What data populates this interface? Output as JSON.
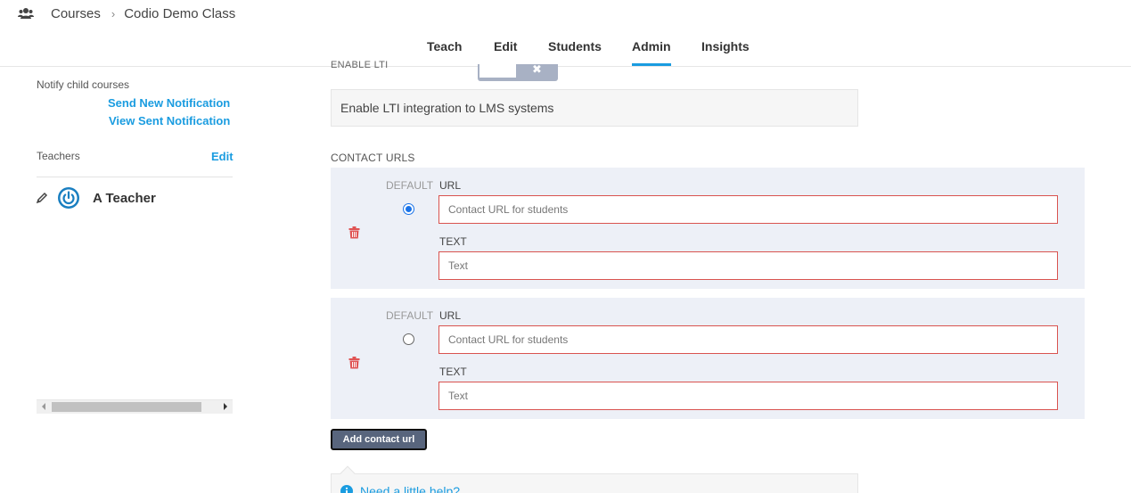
{
  "breadcrumb": {
    "icon": "users-icon",
    "root": "Courses",
    "current": "Codio Demo Class"
  },
  "tabs": [
    {
      "label": "Teach",
      "active": false
    },
    {
      "label": "Edit",
      "active": false
    },
    {
      "label": "Students",
      "active": false
    },
    {
      "label": "Admin",
      "active": true
    },
    {
      "label": "Insights",
      "active": false
    }
  ],
  "sidebar": {
    "notify_label": "Notify child courses",
    "send_new": "Send New Notification",
    "view_sent": "View Sent Notification",
    "teachers_label": "Teachers",
    "teachers_edit": "Edit",
    "teacher_name": "A Teacher"
  },
  "main": {
    "lti_label": "ENABLE LTI",
    "lti_description": "Enable LTI integration to LMS systems",
    "contact_urls_title": "CONTACT URLS",
    "contact_cards": [
      {
        "default_label": "DEFAULT",
        "url_label": "URL",
        "url_placeholder": "Contact URL for students",
        "text_label": "TEXT",
        "text_placeholder": "Text",
        "is_default": true
      },
      {
        "default_label": "DEFAULT",
        "url_label": "URL",
        "url_placeholder": "Contact URL for students",
        "text_label": "TEXT",
        "text_placeholder": "Text",
        "is_default": false
      }
    ],
    "add_button": "Add contact url",
    "help_link": "Need a little help?"
  },
  "colors": {
    "accent": "#1a9ce0",
    "error_border": "#d9534f",
    "card_bg": "#edf0f7",
    "button_bg": "#58657d"
  }
}
